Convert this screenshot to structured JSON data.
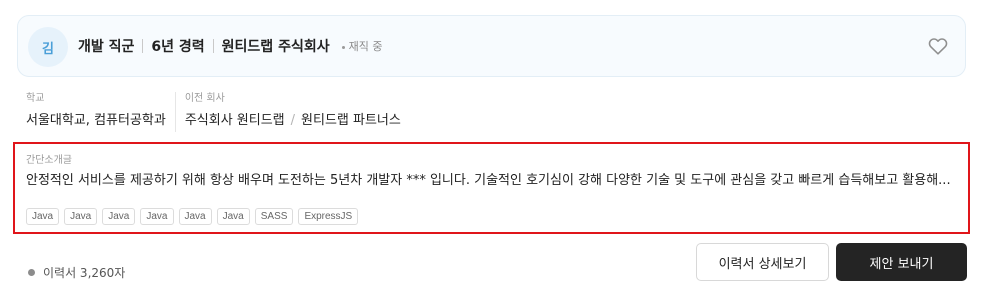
{
  "profile": {
    "avatar_initial": "김",
    "job": "개발 직군",
    "experience": "6년 경력",
    "company": "원티드랩 주식회사",
    "status": "재직 중",
    "favorite_icon": "heart-icon"
  },
  "education": {
    "label": "학교",
    "value": "서울대학교, 컴퓨터공학과"
  },
  "previous": {
    "label": "이전 회사",
    "company_1": "주식회사 원티드랩",
    "company_2": "원티드랩 파트너스",
    "separator": "/"
  },
  "intro": {
    "label": "간단소개글",
    "text": "안정적인 서비스를 제공하기 위해 항상 배우며 도전하는 5년차 개발자 *** 입니다. 기술적인 호기심이 강해 다양한 기술 및 도구에 관심을 갖고 빠르게 습득해보고 활용해...",
    "tags": [
      "Java",
      "Java",
      "Java",
      "Java",
      "Java",
      "Java",
      "SASS",
      "ExpressJS"
    ]
  },
  "footer": {
    "resume_length": "이력서 3,260자",
    "detail_button": "이력서 상세보기",
    "offer_button": "제안 보내기"
  },
  "colors": {
    "highlight_border": "#e0151a",
    "primary_button": "#242424",
    "avatar_bg": "#e6f2fb",
    "avatar_text": "#4a9fd8"
  }
}
